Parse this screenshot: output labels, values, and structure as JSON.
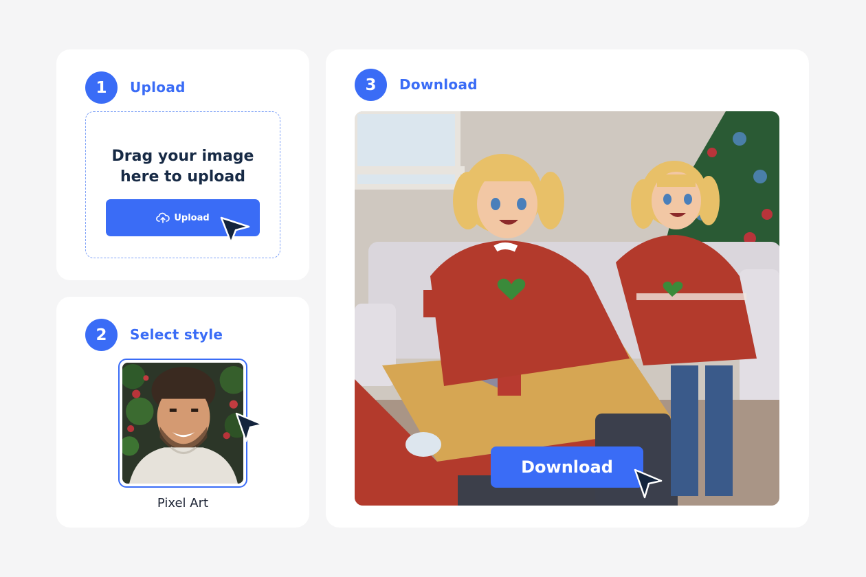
{
  "steps": {
    "upload": {
      "number": "1",
      "title": "Upload",
      "drop_text": "Drag  your image here to upload",
      "button_label": "Upload",
      "button_icon": "cloud-upload-icon"
    },
    "style": {
      "number": "2",
      "title": "Select style",
      "selected_style_label": "Pixel Art"
    },
    "download": {
      "number": "3",
      "title": "Download",
      "button_label": "Download"
    }
  },
  "colors": {
    "accent": "#3a6cf6",
    "background": "#f5f5f6",
    "card": "#ffffff",
    "text_dark": "#172a45"
  }
}
